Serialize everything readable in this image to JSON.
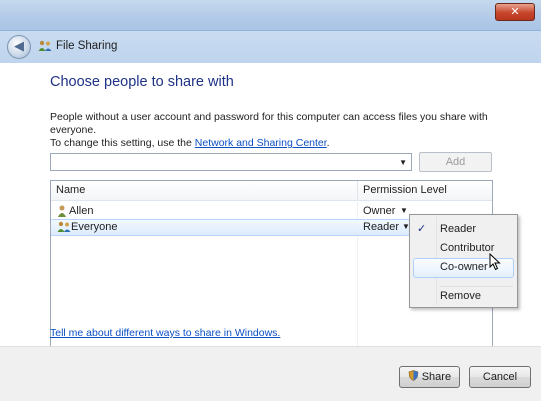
{
  "window": {
    "close_glyph": "✕",
    "back_glyph": "◀",
    "title": "File Sharing"
  },
  "main": {
    "heading": "Choose people to share with",
    "description_line1": "People without a user account and password for this computer can access files you share with everyone.",
    "description_line2_prefix": "To change this setting, use the ",
    "description_link": "Network and Sharing Center",
    "description_line2_suffix": ".",
    "combo_value": "",
    "add_label": "Add"
  },
  "list": {
    "col_name": "Name",
    "col_permission": "Permission Level",
    "rows": [
      {
        "name": "Allen",
        "permission": "Owner",
        "icon": "user-icon"
      },
      {
        "name": "Everyone",
        "permission": "Reader",
        "icon": "group-icon",
        "selected": true
      }
    ]
  },
  "menu": {
    "items": [
      {
        "label": "Reader",
        "checked": true
      },
      {
        "label": "Contributor"
      },
      {
        "label": "Co-owner",
        "hover": true
      },
      {
        "label": "Remove"
      }
    ],
    "check_glyph": "✓"
  },
  "help_link": "Tell me about different ways to share in Windows.",
  "footer": {
    "share_label": "Share",
    "cancel_label": "Cancel"
  },
  "colors": {
    "heading": "#1e3287",
    "link": "#0b4fc4",
    "titlebar": "#b9d1ea",
    "selection": "#dcebfc"
  }
}
